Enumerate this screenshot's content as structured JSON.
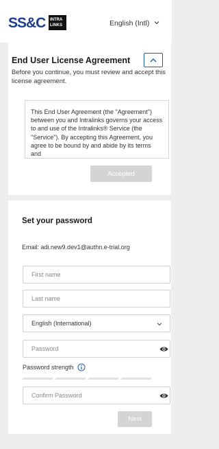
{
  "header": {
    "logo_ssc": "SS&C",
    "logo_intralinks_line1": "INTRA",
    "logo_intralinks_line2": "LINKS",
    "language": "English (Intl)"
  },
  "eula": {
    "title": "End User License Agreement",
    "intro": "Before you continue, you must review and accept this license agreement.",
    "text": "This End User Agreement (the \"Agreement\") between you and Intralinks governs your access to and use of the Intralinks® Service (the \"Service\"). By accepting this Agreement, you agree to be bound by and abide by its terms and",
    "accepted_label": "Accepted"
  },
  "password_form": {
    "title": "Set your password",
    "email_label": "Email:",
    "email_value": "adi.new9.dev1@authn.e-trial.org",
    "first_name_placeholder": "First name",
    "last_name_placeholder": "Last name",
    "language_value": "English (International)",
    "password_placeholder": "Password",
    "strength_label": "Password strength",
    "confirm_placeholder": "Confirm Password",
    "next_label": "Next"
  },
  "colors": {
    "brand_blue": "#1b3f8f",
    "accent_blue": "#1f5fa8",
    "disabled_button": "#d4d4d4",
    "background": "#eeeeee"
  },
  "icons": {
    "language_dropdown": "chevron-down-icon",
    "eula_toggle": "chevron-up-icon",
    "select_dropdown": "chevron-down-icon",
    "password_visibility": "eye-icon",
    "strength_info": "info-icon"
  }
}
